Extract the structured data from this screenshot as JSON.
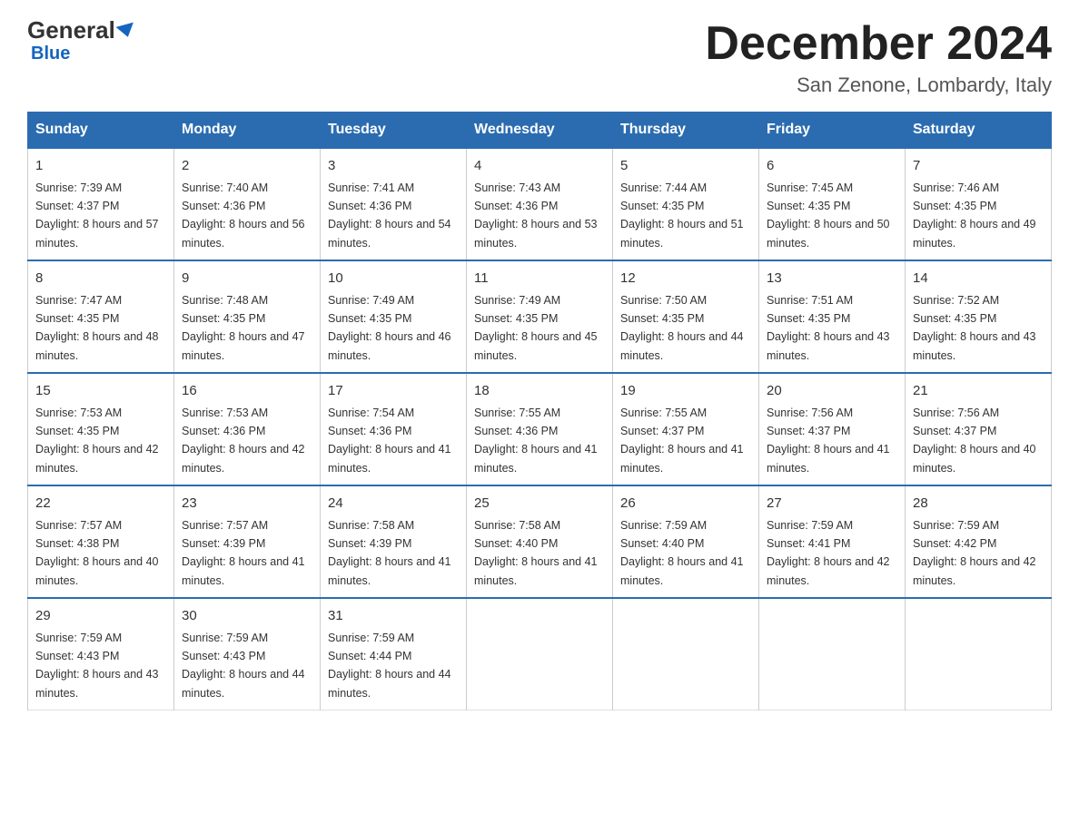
{
  "logo": {
    "general": "General",
    "arrow": "",
    "blue": "Blue"
  },
  "header": {
    "title": "December 2024",
    "location": "San Zenone, Lombardy, Italy"
  },
  "days_of_week": [
    "Sunday",
    "Monday",
    "Tuesday",
    "Wednesday",
    "Thursday",
    "Friday",
    "Saturday"
  ],
  "weeks": [
    [
      {
        "day": "1",
        "sunrise": "7:39 AM",
        "sunset": "4:37 PM",
        "daylight": "8 hours and 57 minutes."
      },
      {
        "day": "2",
        "sunrise": "7:40 AM",
        "sunset": "4:36 PM",
        "daylight": "8 hours and 56 minutes."
      },
      {
        "day": "3",
        "sunrise": "7:41 AM",
        "sunset": "4:36 PM",
        "daylight": "8 hours and 54 minutes."
      },
      {
        "day": "4",
        "sunrise": "7:43 AM",
        "sunset": "4:36 PM",
        "daylight": "8 hours and 53 minutes."
      },
      {
        "day": "5",
        "sunrise": "7:44 AM",
        "sunset": "4:35 PM",
        "daylight": "8 hours and 51 minutes."
      },
      {
        "day": "6",
        "sunrise": "7:45 AM",
        "sunset": "4:35 PM",
        "daylight": "8 hours and 50 minutes."
      },
      {
        "day": "7",
        "sunrise": "7:46 AM",
        "sunset": "4:35 PM",
        "daylight": "8 hours and 49 minutes."
      }
    ],
    [
      {
        "day": "8",
        "sunrise": "7:47 AM",
        "sunset": "4:35 PM",
        "daylight": "8 hours and 48 minutes."
      },
      {
        "day": "9",
        "sunrise": "7:48 AM",
        "sunset": "4:35 PM",
        "daylight": "8 hours and 47 minutes."
      },
      {
        "day": "10",
        "sunrise": "7:49 AM",
        "sunset": "4:35 PM",
        "daylight": "8 hours and 46 minutes."
      },
      {
        "day": "11",
        "sunrise": "7:49 AM",
        "sunset": "4:35 PM",
        "daylight": "8 hours and 45 minutes."
      },
      {
        "day": "12",
        "sunrise": "7:50 AM",
        "sunset": "4:35 PM",
        "daylight": "8 hours and 44 minutes."
      },
      {
        "day": "13",
        "sunrise": "7:51 AM",
        "sunset": "4:35 PM",
        "daylight": "8 hours and 43 minutes."
      },
      {
        "day": "14",
        "sunrise": "7:52 AM",
        "sunset": "4:35 PM",
        "daylight": "8 hours and 43 minutes."
      }
    ],
    [
      {
        "day": "15",
        "sunrise": "7:53 AM",
        "sunset": "4:35 PM",
        "daylight": "8 hours and 42 minutes."
      },
      {
        "day": "16",
        "sunrise": "7:53 AM",
        "sunset": "4:36 PM",
        "daylight": "8 hours and 42 minutes."
      },
      {
        "day": "17",
        "sunrise": "7:54 AM",
        "sunset": "4:36 PM",
        "daylight": "8 hours and 41 minutes."
      },
      {
        "day": "18",
        "sunrise": "7:55 AM",
        "sunset": "4:36 PM",
        "daylight": "8 hours and 41 minutes."
      },
      {
        "day": "19",
        "sunrise": "7:55 AM",
        "sunset": "4:37 PM",
        "daylight": "8 hours and 41 minutes."
      },
      {
        "day": "20",
        "sunrise": "7:56 AM",
        "sunset": "4:37 PM",
        "daylight": "8 hours and 41 minutes."
      },
      {
        "day": "21",
        "sunrise": "7:56 AM",
        "sunset": "4:37 PM",
        "daylight": "8 hours and 40 minutes."
      }
    ],
    [
      {
        "day": "22",
        "sunrise": "7:57 AM",
        "sunset": "4:38 PM",
        "daylight": "8 hours and 40 minutes."
      },
      {
        "day": "23",
        "sunrise": "7:57 AM",
        "sunset": "4:39 PM",
        "daylight": "8 hours and 41 minutes."
      },
      {
        "day": "24",
        "sunrise": "7:58 AM",
        "sunset": "4:39 PM",
        "daylight": "8 hours and 41 minutes."
      },
      {
        "day": "25",
        "sunrise": "7:58 AM",
        "sunset": "4:40 PM",
        "daylight": "8 hours and 41 minutes."
      },
      {
        "day": "26",
        "sunrise": "7:59 AM",
        "sunset": "4:40 PM",
        "daylight": "8 hours and 41 minutes."
      },
      {
        "day": "27",
        "sunrise": "7:59 AM",
        "sunset": "4:41 PM",
        "daylight": "8 hours and 42 minutes."
      },
      {
        "day": "28",
        "sunrise": "7:59 AM",
        "sunset": "4:42 PM",
        "daylight": "8 hours and 42 minutes."
      }
    ],
    [
      {
        "day": "29",
        "sunrise": "7:59 AM",
        "sunset": "4:43 PM",
        "daylight": "8 hours and 43 minutes."
      },
      {
        "day": "30",
        "sunrise": "7:59 AM",
        "sunset": "4:43 PM",
        "daylight": "8 hours and 44 minutes."
      },
      {
        "day": "31",
        "sunrise": "7:59 AM",
        "sunset": "4:44 PM",
        "daylight": "8 hours and 44 minutes."
      },
      null,
      null,
      null,
      null
    ]
  ]
}
